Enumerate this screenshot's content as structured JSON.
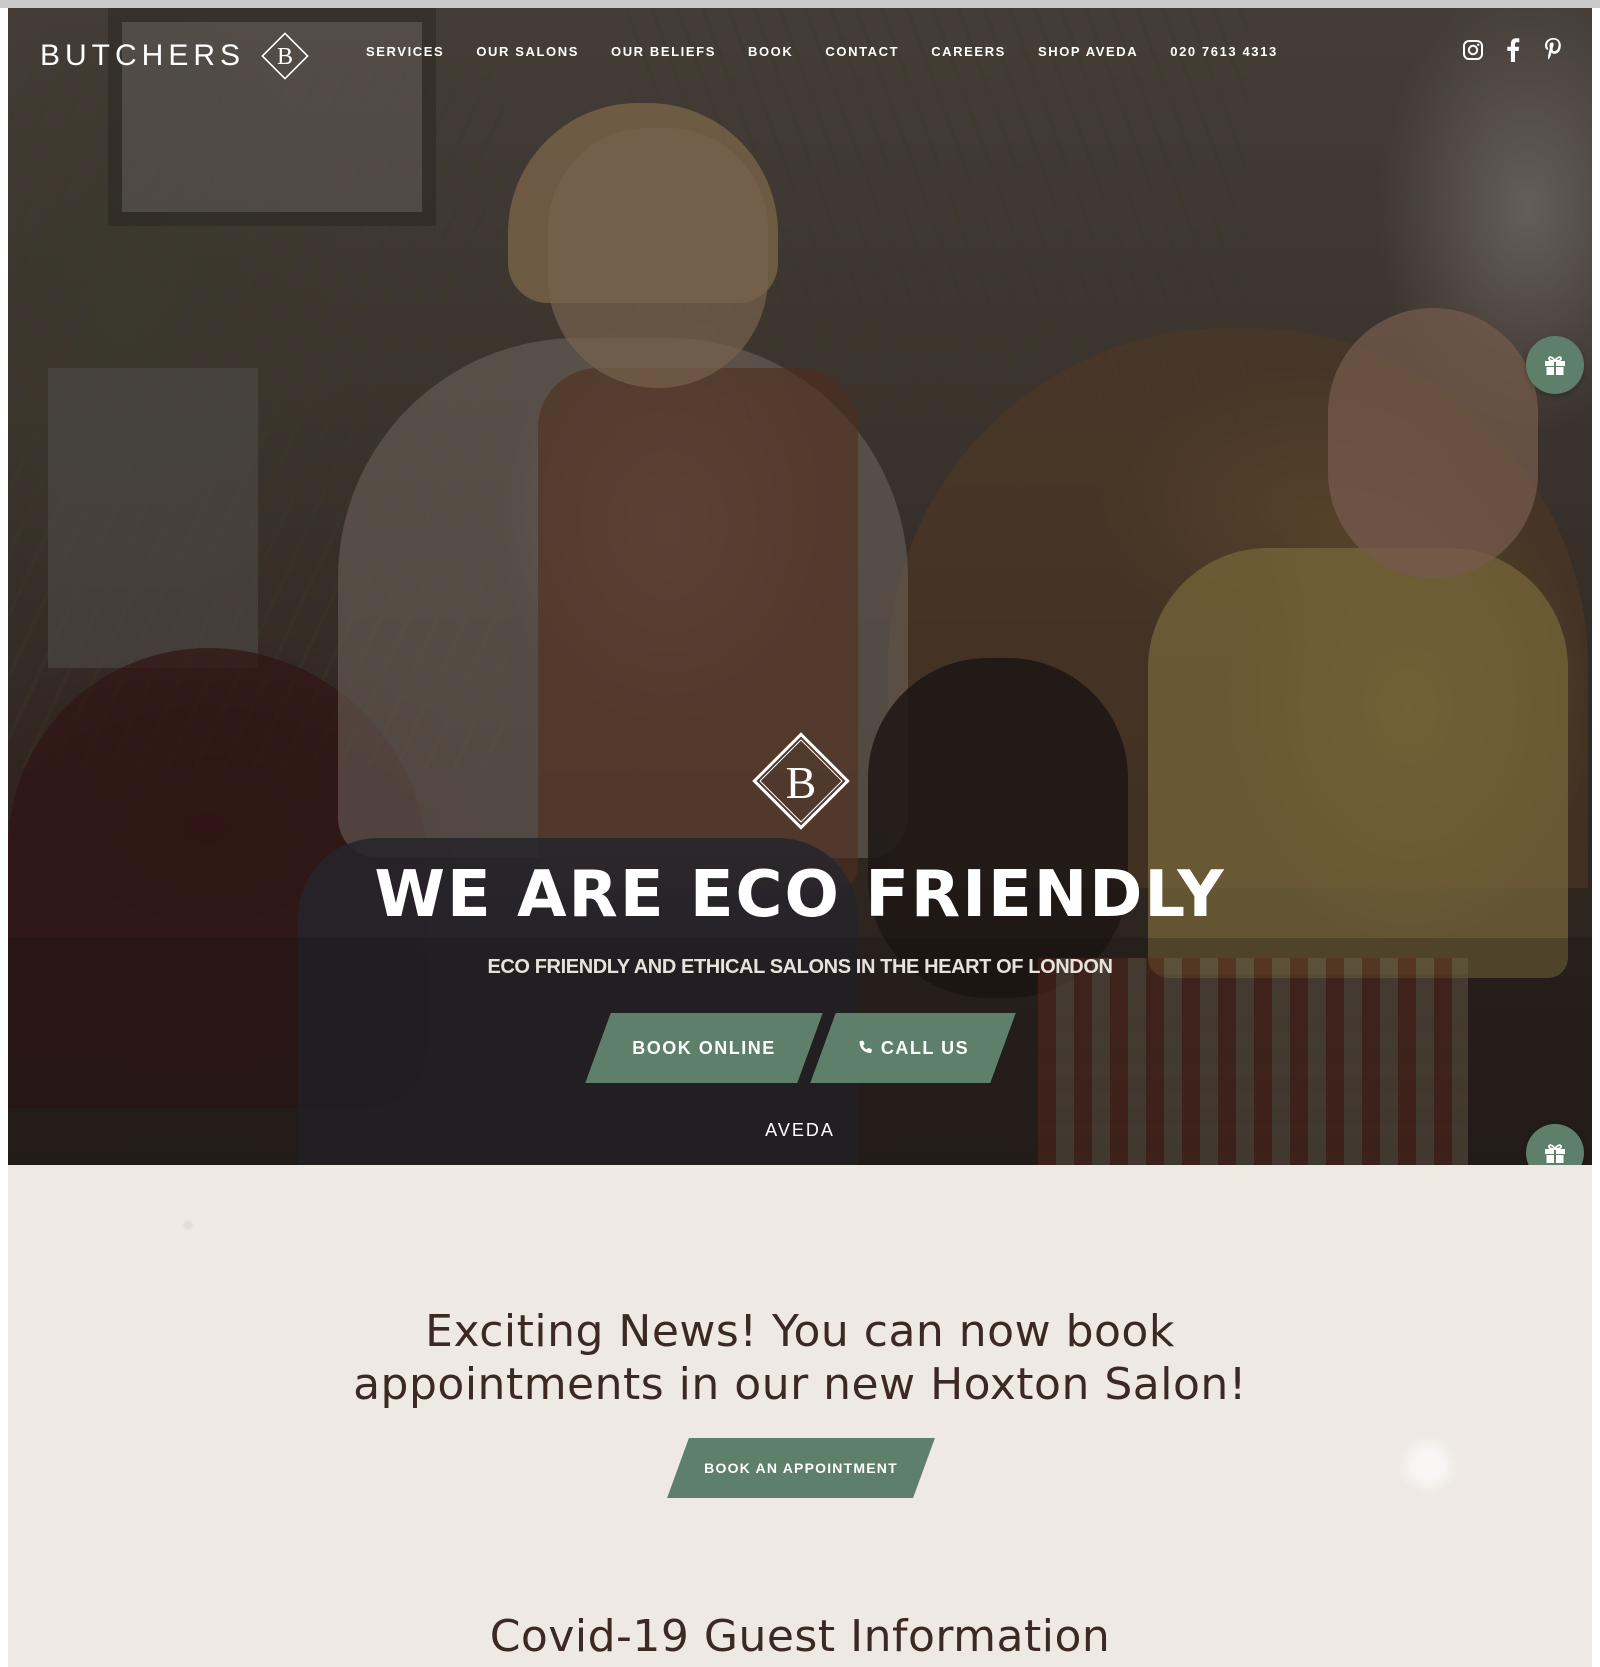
{
  "brand": {
    "name": "BUTCHERS",
    "monogram": "B"
  },
  "nav": {
    "items": [
      {
        "label": "SERVICES"
      },
      {
        "label": "OUR SALONS"
      },
      {
        "label": "OUR BELIEFS"
      },
      {
        "label": "BOOK"
      },
      {
        "label": "CONTACT"
      },
      {
        "label": "CAREERS"
      },
      {
        "label": "SHOP AVEDA"
      },
      {
        "label": "020 7613 4313"
      }
    ]
  },
  "social": {
    "icons": [
      "instagram-icon",
      "facebook-icon",
      "pinterest-icon"
    ]
  },
  "hero": {
    "title": "WE ARE ECO FRIENDLY",
    "subtitle": "ECO FRIENDLY AND ETHICAL SALONS IN THE HEART OF LONDON",
    "book_label": "BOOK ONLINE",
    "call_label": "CALL US",
    "partner": "AVEDA"
  },
  "news": {
    "headline": "Exciting News! You can now book appointments in our new Hoxton Salon!",
    "cta_label": "BOOK AN APPOINTMENT"
  },
  "covid": {
    "heading": "Covid-19 Guest Information"
  },
  "colors": {
    "accent": "#5e7f69",
    "heading_text": "#3b2a22",
    "section_bg": "#efe9e4"
  }
}
